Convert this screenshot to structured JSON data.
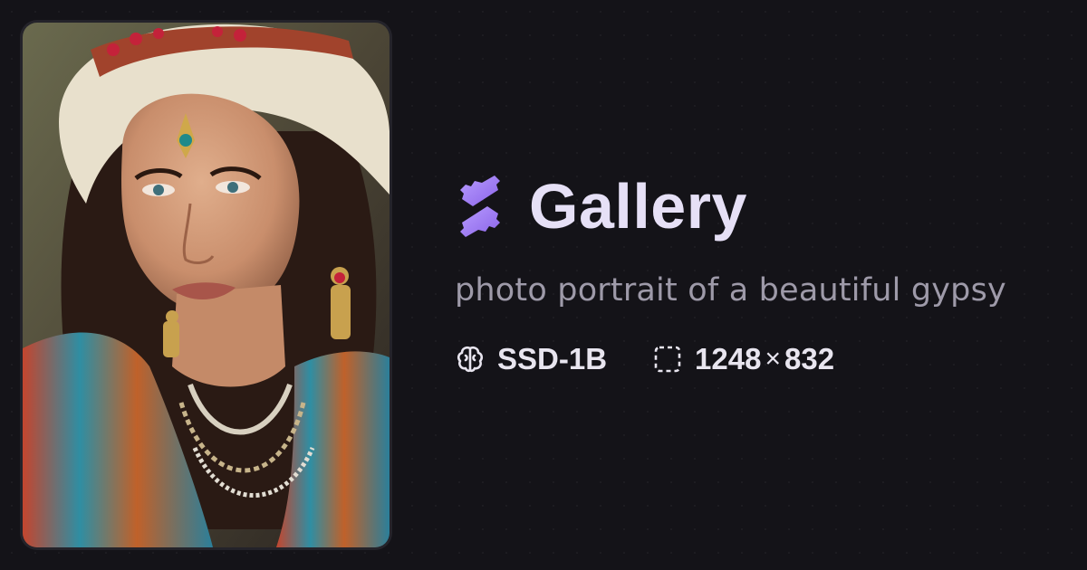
{
  "card": {
    "image_alt": "photo portrait of a beautiful gypsy"
  },
  "brand": {
    "logo_icon": "gallery-logo-icon",
    "title": "Gallery",
    "accent": "#9f7cf2"
  },
  "prompt": "photo portrait of a beautiful gypsy",
  "meta": {
    "model_icon": "brain-icon",
    "model": "SSD-1B",
    "size_icon": "dashed-frame-icon",
    "width": "1248",
    "times": "×",
    "height": "832"
  }
}
